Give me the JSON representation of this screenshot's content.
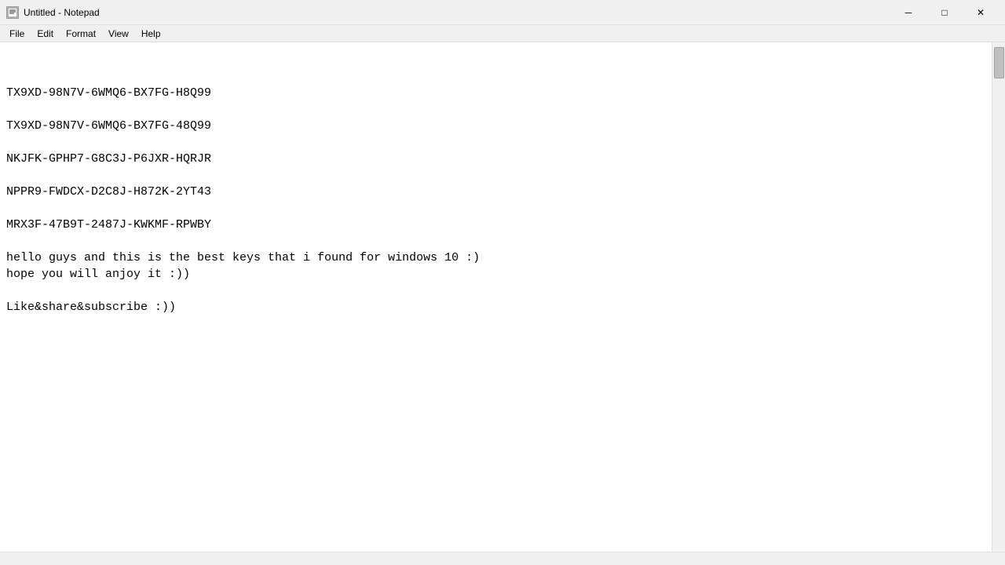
{
  "window": {
    "title": "Untitled - Notepad",
    "icon_label": "notepad-icon"
  },
  "titlebar": {
    "minimize_label": "─",
    "maximize_label": "□",
    "close_label": "✕"
  },
  "menubar": {
    "items": [
      {
        "label": "File"
      },
      {
        "label": "Edit"
      },
      {
        "label": "Format"
      },
      {
        "label": "View"
      },
      {
        "label": "Help"
      }
    ]
  },
  "editor": {
    "lines": [
      {
        "text": "TX9XD-98N7V-6WMQ6-BX7FG-H8Q99",
        "empty": false
      },
      {
        "text": "",
        "empty": true
      },
      {
        "text": "TX9XD-98N7V-6WMQ6-BX7FG-48Q99",
        "empty": false
      },
      {
        "text": "",
        "empty": true
      },
      {
        "text": "NKJFK-GPHP7-G8C3J-P6JXR-HQRJR",
        "empty": false
      },
      {
        "text": "",
        "empty": true
      },
      {
        "text": "NPPR9-FWDCX-D2C8J-H872K-2YT43",
        "empty": false
      },
      {
        "text": "",
        "empty": true
      },
      {
        "text": "MRX3F-47B9T-2487J-KWKMF-RPWBY",
        "empty": false
      },
      {
        "text": "",
        "empty": true
      },
      {
        "text": "hello guys and this is the best keys that i found for windows 10 :)",
        "empty": false
      },
      {
        "text": "hope you will anjoy it :))",
        "empty": false
      },
      {
        "text": "",
        "empty": true
      },
      {
        "text": "Like&share&subscribe :))",
        "empty": false
      }
    ]
  }
}
